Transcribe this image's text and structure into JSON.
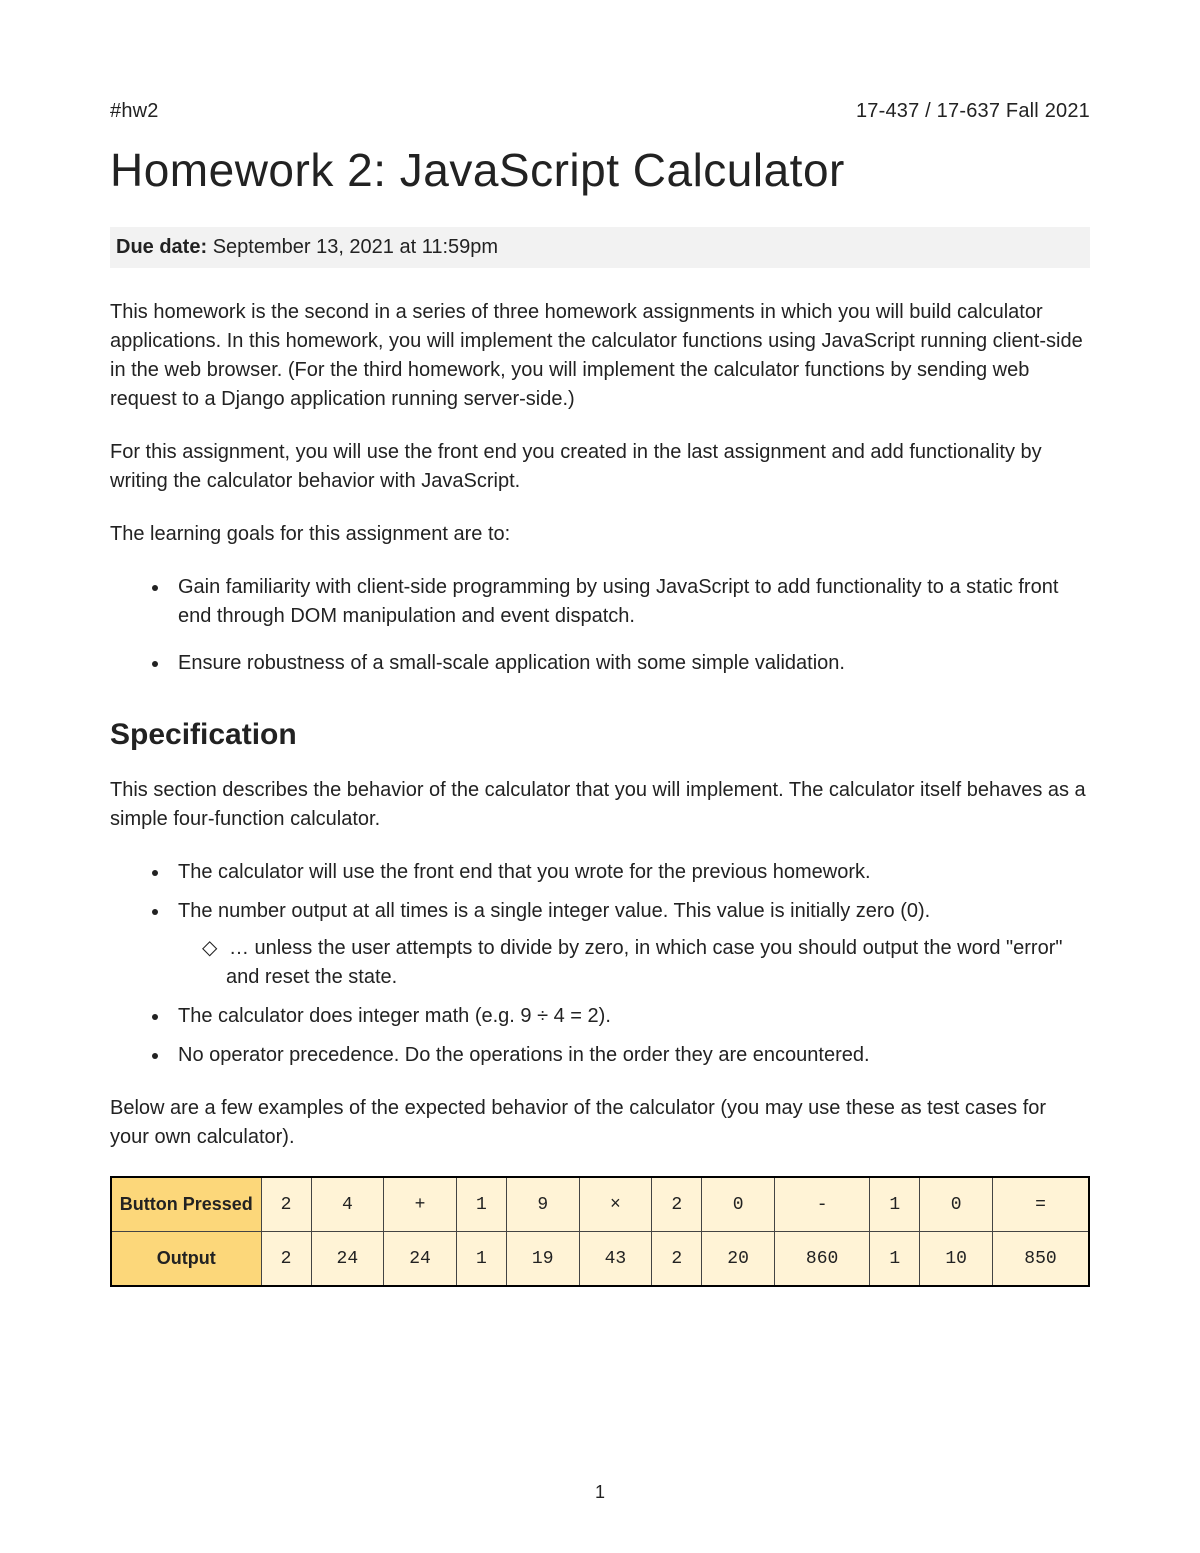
{
  "header": {
    "tag": "#hw2",
    "course": "17-437 / 17-637 Fall 2021"
  },
  "title": "Homework 2: JavaScript Calculator",
  "due": {
    "label": "Due date:",
    "value": "September 13, 2021 at 11:59pm"
  },
  "intro_paragraphs": [
    "This homework is the second in a series of three homework assignments in which you will build calculator applications. In this homework, you will implement the calculator functions using JavaScript running client-side in the web browser. (For the third homework, you will implement the calculator functions by sending web request to a Django application running server-side.)",
    "For this assignment, you will use the front end you created in the last assignment and add functionality by writing the calculator behavior with JavaScript.",
    "The learning goals for this assignment are to:"
  ],
  "learning_goals": [
    "Gain familiarity with client-side programming by using JavaScript to add functionality to a static front end through DOM manipulation and event dispatch.",
    "Ensure robustness of a small-scale application with some simple validation."
  ],
  "spec": {
    "heading": "Specification",
    "intro": "This section describes the behavior of the calculator that you will implement. The calculator itself behaves as a simple four-function calculator.",
    "bullets": [
      "The calculator will use the front end that you wrote for the previous homework.",
      "The number output at all times is a single integer value. This value is initially zero (0).",
      "The calculator does integer math (e.g. 9 ÷ 4 = 2).",
      "No operator precedence. Do the operations in the order they are encountered."
    ],
    "sub_bullet": "… unless the user attempts to divide by zero, in which case you should output the word \"error\" and reset the state.",
    "below": "Below are a few examples of the expected behavior of the calculator (you may use these as test cases for your own calculator)."
  },
  "table": {
    "row1_label": "Button Pressed",
    "row2_label": "Output",
    "buttons": [
      "2",
      "4",
      "+",
      "1",
      "9",
      "×",
      "2",
      "0",
      "-",
      "1",
      "0",
      "="
    ],
    "outputs": [
      "2",
      "24",
      "24",
      "1",
      "19",
      "43",
      "2",
      "20",
      "860",
      "1",
      "10",
      "850"
    ]
  },
  "page_number": "1"
}
